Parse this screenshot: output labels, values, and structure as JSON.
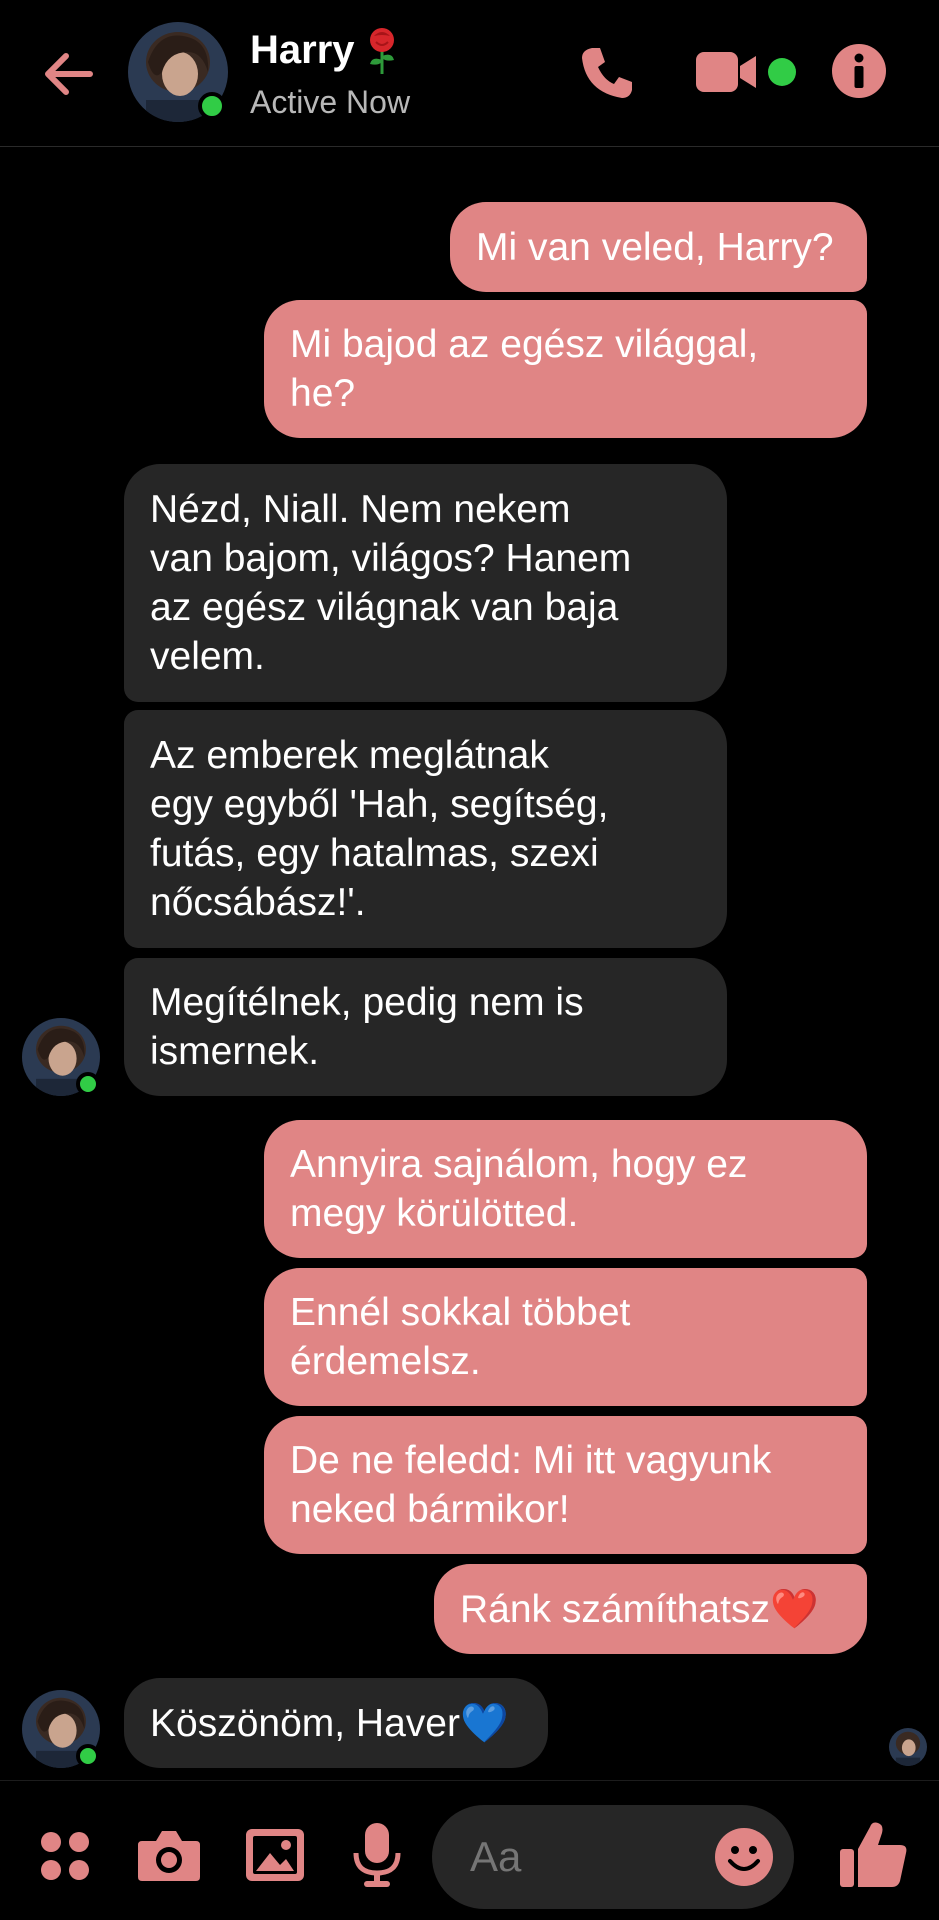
{
  "header": {
    "contact_name": "Harry",
    "status": "Active Now"
  },
  "messages": [
    {
      "side": "out",
      "text": "Mi van veled, Harry?"
    },
    {
      "side": "out",
      "text": "Mi bajod az egész világgal,\nhe?"
    },
    {
      "side": "in",
      "text": "Nézd, Niall. Nem nekem\nvan bajom, világos? Hanem\naz egész világnak van baja\nvelem."
    },
    {
      "side": "in",
      "text": "Az emberek meglátnak\negy egyből 'Hah, segítség,\nfutás, egy hatalmas, szexi\nnőcsábász!'."
    },
    {
      "side": "in",
      "text": "Megítélnek, pedig nem is\nismernek."
    },
    {
      "side": "out",
      "text": "Annyira sajnálom, hogy ez\nmegy körülötted."
    },
    {
      "side": "out",
      "text": "Ennél sokkal többet\nérdemelsz."
    },
    {
      "side": "out",
      "text": "De ne feledd: Mi itt vagyunk\nneked bármikor!"
    },
    {
      "side": "out",
      "text": "Ránk számíthatsz❤️"
    },
    {
      "side": "in",
      "text": "Köszönöm, Haver💙"
    }
  ],
  "composer": {
    "placeholder": "Aa"
  },
  "colors": {
    "accent": "#e08585",
    "incoming_bubble": "#262626",
    "online": "#31cc46",
    "background": "#000000"
  },
  "icons": [
    "back-arrow-icon",
    "rose-icon",
    "phone-icon",
    "video-camera-icon",
    "info-icon",
    "apps-icon",
    "camera-icon",
    "gallery-icon",
    "microphone-icon",
    "emoji-icon",
    "thumbs-up-icon"
  ]
}
